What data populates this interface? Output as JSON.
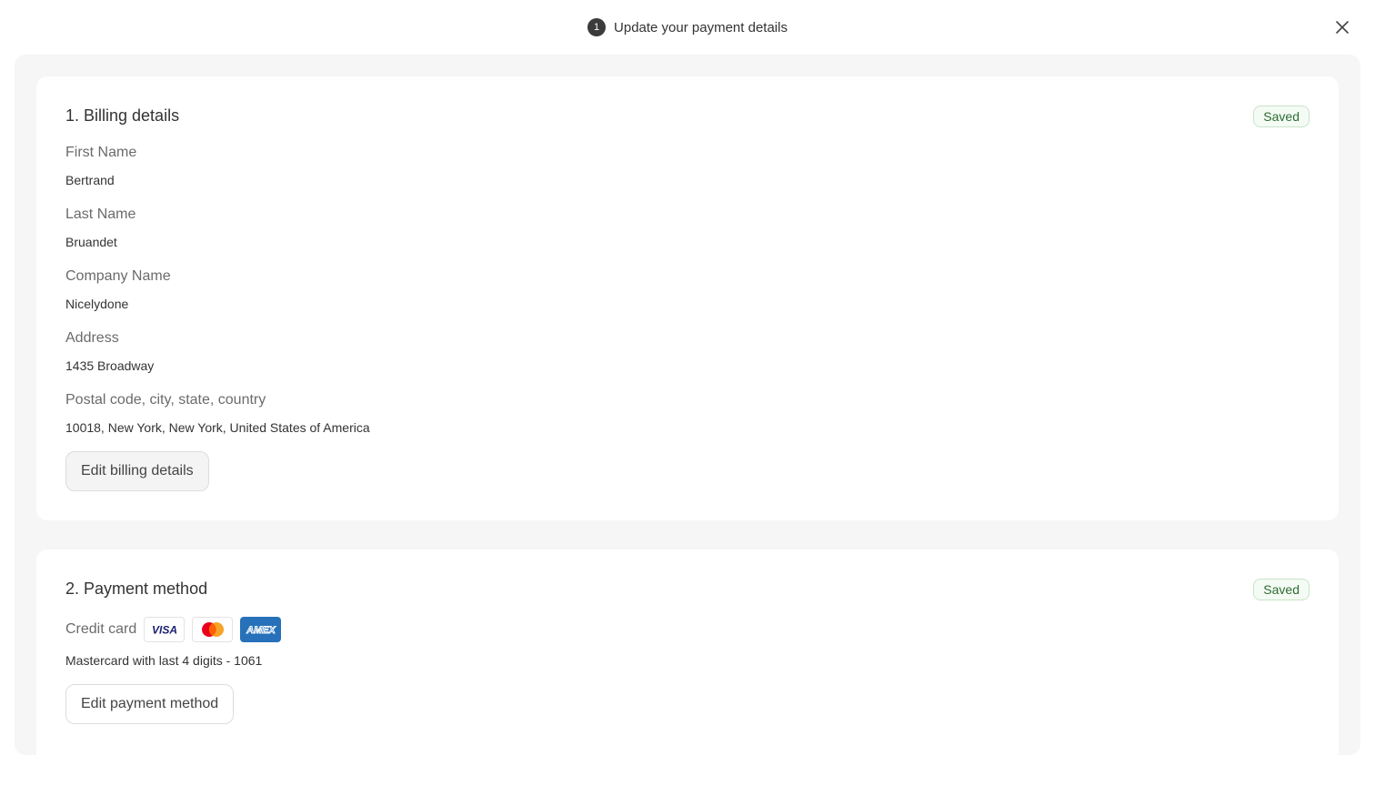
{
  "header": {
    "step_number": "1",
    "title": "Update your payment details"
  },
  "billing": {
    "title": "1. Billing details",
    "status": "Saved",
    "fields": [
      {
        "label": "First Name",
        "value": "Bertrand"
      },
      {
        "label": "Last Name",
        "value": "Bruandet"
      },
      {
        "label": "Company Name",
        "value": "Nicelydone"
      },
      {
        "label": "Address",
        "value": "1435 Broadway"
      },
      {
        "label": "Postal code, city, state, country",
        "value": "10018, New York, New York, United States of America"
      }
    ],
    "edit_label": "Edit billing details"
  },
  "payment": {
    "title": "2. Payment method",
    "status": "Saved",
    "method_label": "Credit card",
    "card_logos": [
      {
        "name": "visa-logo",
        "text": "VISA",
        "color": "#1a1f71"
      },
      {
        "name": "mastercard-logo",
        "colors": [
          "#eb001b",
          "#f79e1b"
        ]
      },
      {
        "name": "amex-logo",
        "text": "AMEX",
        "color": "#2671b9"
      }
    ],
    "card_summary": "Mastercard with last 4 digits - 1061",
    "edit_label": "Edit payment method"
  },
  "colors": {
    "saved_text": "#2e6b33",
    "saved_border": "#c9e3c9",
    "panel_bg": "#f6f6f6"
  }
}
